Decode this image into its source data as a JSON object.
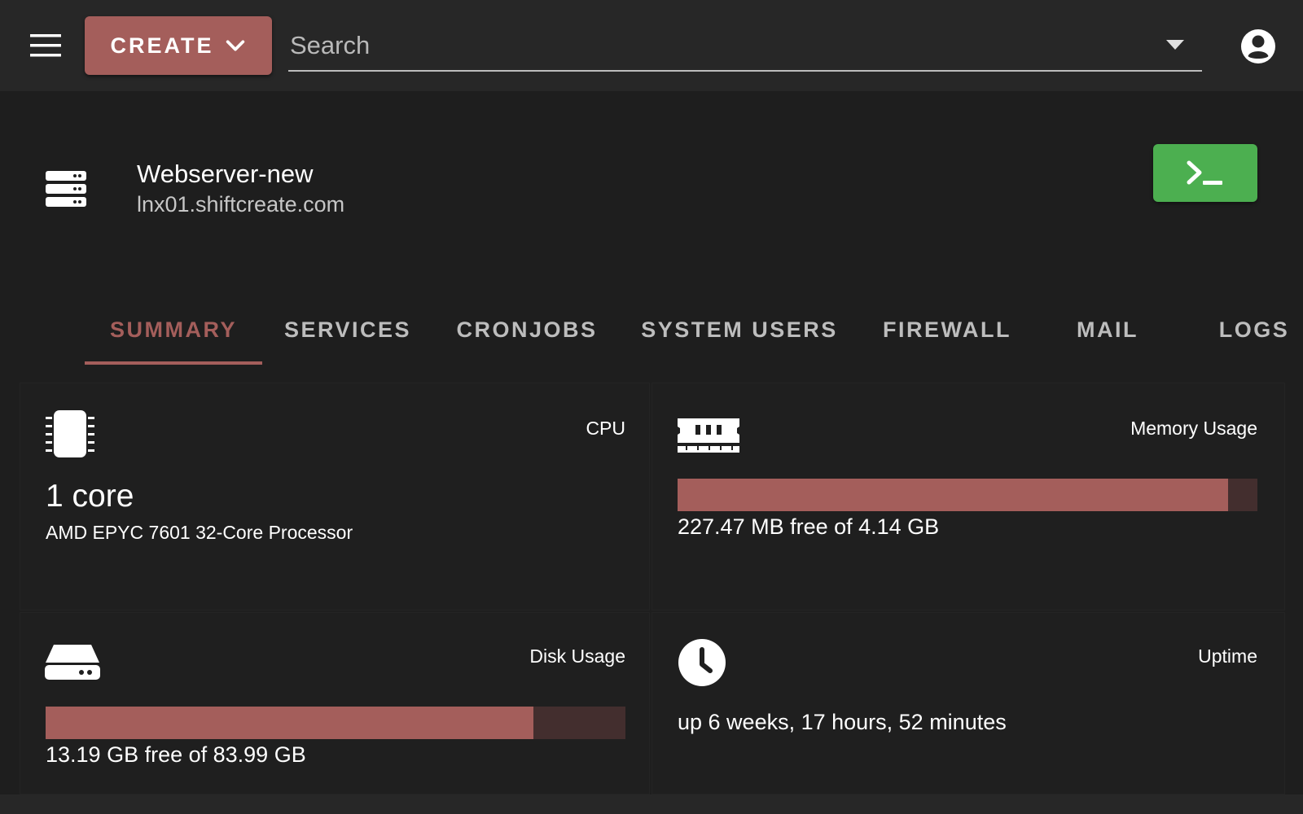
{
  "header": {
    "create_label": "CREATE",
    "search_placeholder": "Search"
  },
  "server": {
    "name": "Webserver-new",
    "host": "lnx01.shiftcreate.com"
  },
  "tabs": [
    {
      "label": "SUMMARY",
      "active": true
    },
    {
      "label": "SERVICES",
      "active": false
    },
    {
      "label": "CRONJOBS",
      "active": false
    },
    {
      "label": "SYSTEM USERS",
      "active": false
    },
    {
      "label": "FIREWALL",
      "active": false
    },
    {
      "label": "MAIL",
      "active": false
    },
    {
      "label": "LOGS",
      "active": false
    }
  ],
  "cpu": {
    "title": "CPU",
    "cores": "1 core",
    "model": "AMD EPYC 7601 32-Core Processor"
  },
  "memory": {
    "title": "Memory Usage",
    "used_fraction": 0.949,
    "text": "227.47 MB free of 4.14 GB"
  },
  "disk": {
    "title": "Disk Usage",
    "used_fraction": 0.841,
    "text": "13.19 GB free of 83.99 GB"
  },
  "uptime": {
    "title": "Uptime",
    "text": "up 6 weeks, 17 hours, 52 minutes"
  },
  "colors": {
    "accent": "#a45e5b",
    "terminal": "#4caf50",
    "bar_track": "#432e2e",
    "background": "#1e1e1e",
    "topbar": "#272727"
  }
}
